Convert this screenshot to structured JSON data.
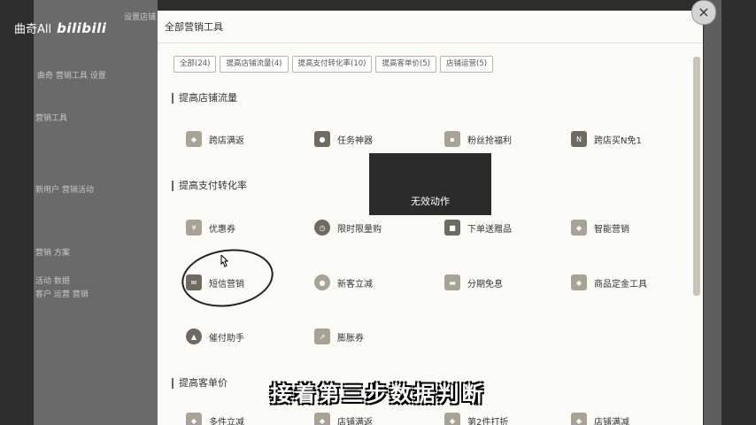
{
  "watermark": {
    "channel": "曲奇All",
    "brand": "bilibili"
  },
  "background": {
    "texts": [
      "设置店铺",
      "曲奇 营销工具 设置",
      "营销工具",
      "新用户 营销活动",
      "营销 方案",
      "活动 数据",
      "客户 运营 营销"
    ]
  },
  "modal": {
    "title": "全部营销工具",
    "close_glyph": "×",
    "tabs": [
      {
        "label": "全部(24)"
      },
      {
        "label": "提高店铺流量(4)"
      },
      {
        "label": "提高支付转化率(10)"
      },
      {
        "label": "提高客单价(5)"
      },
      {
        "label": "店铺运营(5)"
      }
    ],
    "sections": [
      {
        "title": "提高店铺流量",
        "tools": [
          "跨店满返",
          "任务神器",
          "粉丝抢福利",
          "跨店买N免1"
        ]
      },
      {
        "title": "提高支付转化率",
        "tools": [
          "优惠券",
          "限时限量购",
          "下单送赠品",
          "智能营销",
          "短信营销",
          "新客立减",
          "分期免息",
          "商品定金工具",
          "催付助手",
          "膨胀券"
        ]
      },
      {
        "title": "提高客单价",
        "tools": [
          "多件立减",
          "店铺满返",
          "第2件打折",
          "店铺满减"
        ]
      }
    ]
  },
  "toast": {
    "text": "无效动作"
  },
  "subtitle": {
    "text": "接着第三步数据判断"
  },
  "colors": {
    "accent": "#a8a394",
    "modal_bg": "#fbfbf7",
    "overlay": "#2e2e2e"
  }
}
